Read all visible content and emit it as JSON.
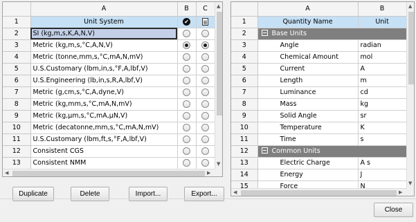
{
  "left_table": {
    "columns": [
      "A",
      "B",
      "C"
    ],
    "header": {
      "row": "1",
      "label": "Unit System"
    },
    "rows": [
      {
        "num": "2",
        "label": "SI (kg,m,s,K,A,N,V)",
        "b": false,
        "c": false,
        "selected": true
      },
      {
        "num": "3",
        "label": "Metric (kg,m,s,°C,A,N,V)",
        "b": true,
        "c": true,
        "selected": false
      },
      {
        "num": "4",
        "label": "Metric (tonne,mm,s,°C,mA,N,mV)",
        "b": false,
        "c": false,
        "selected": false
      },
      {
        "num": "5",
        "label": "U.S.Customary (lbm,in,s,°F,A,lbf,V)",
        "b": false,
        "c": false,
        "selected": false
      },
      {
        "num": "6",
        "label": "U.S.Engineering (lb,in,s,R,A,lbf,V)",
        "b": false,
        "c": false,
        "selected": false
      },
      {
        "num": "7",
        "label": "Metric (g,cm,s,°C,A,dyne,V)",
        "b": false,
        "c": false,
        "selected": false
      },
      {
        "num": "8",
        "label": "Metric (kg,mm,s,°C,mA,N,mV)",
        "b": false,
        "c": false,
        "selected": false
      },
      {
        "num": "9",
        "label": "Metric (kg,μm,s,°C,mA,μN,V)",
        "b": false,
        "c": false,
        "selected": false
      },
      {
        "num": "10",
        "label": "Metric (decatonne,mm,s,°C,mA,N,mV)",
        "b": false,
        "c": false,
        "selected": false
      },
      {
        "num": "11",
        "label": "U.S.Customary (lbm,ft,s,°F,A,lbf,V)",
        "b": false,
        "c": false,
        "selected": false
      },
      {
        "num": "12",
        "label": "Consistent CGS",
        "b": false,
        "c": false,
        "selected": false
      },
      {
        "num": "13",
        "label": "Consistent NMM",
        "b": false,
        "c": false,
        "selected": false
      }
    ]
  },
  "right_table": {
    "columns": [
      "A",
      "B"
    ],
    "header": {
      "row": "1",
      "name": "Quantity Name",
      "unit": "Unit"
    },
    "rows": [
      {
        "num": "2",
        "type": "group",
        "name": "Base Units"
      },
      {
        "num": "3",
        "name": "Angle",
        "unit": "radian"
      },
      {
        "num": "4",
        "name": "Chemical Amount",
        "unit": "mol"
      },
      {
        "num": "5",
        "name": "Current",
        "unit": "A"
      },
      {
        "num": "6",
        "name": "Length",
        "unit": "m"
      },
      {
        "num": "7",
        "name": "Luminance",
        "unit": "cd"
      },
      {
        "num": "8",
        "name": "Mass",
        "unit": "kg"
      },
      {
        "num": "9",
        "name": "Solid Angle",
        "unit": "sr"
      },
      {
        "num": "10",
        "name": "Temperature",
        "unit": "K"
      },
      {
        "num": "11",
        "name": "Time",
        "unit": "s"
      },
      {
        "num": "12",
        "type": "group",
        "name": "Common Units"
      },
      {
        "num": "13",
        "name": "Electric Charge",
        "unit": "A s"
      },
      {
        "num": "14",
        "name": "Energy",
        "unit": "J"
      },
      {
        "num": "15",
        "name": "Force",
        "unit": "N"
      }
    ]
  },
  "buttons": {
    "duplicate": "Duplicate",
    "delete": "Delete",
    "import": "Import...",
    "export": "Export...",
    "close": "Close"
  },
  "colors": {
    "header_row": "#c6e0f5",
    "selected_row": "#c4d0e8",
    "group_row": "#7f7f7f"
  }
}
